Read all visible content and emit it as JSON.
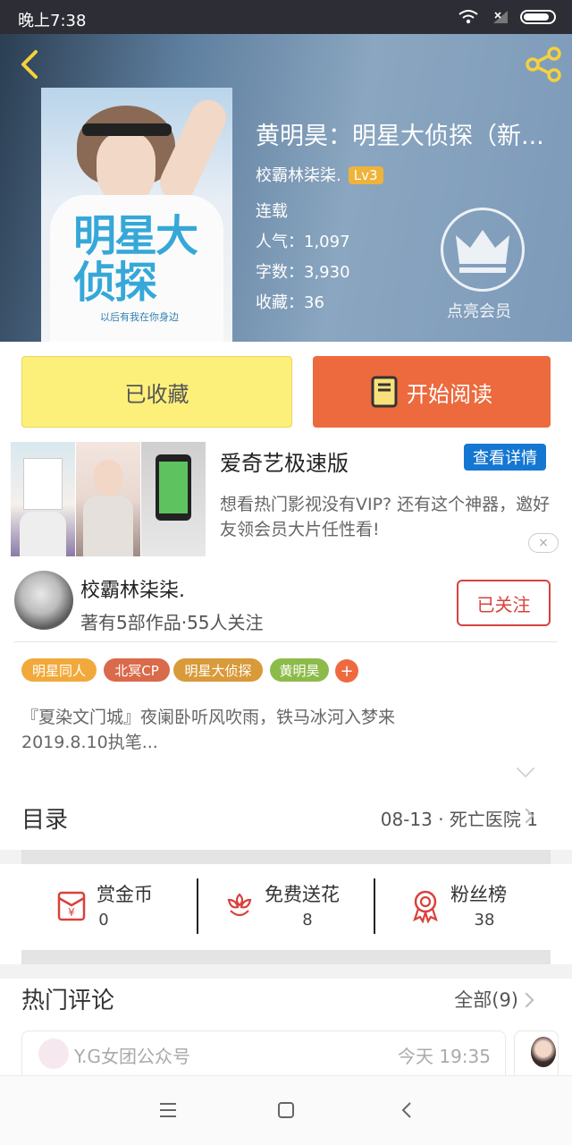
{
  "status": {
    "time": "晚上7:38"
  },
  "book": {
    "title": "黄明昊：明星大侦探（新...",
    "author": "校霸林柒柒.",
    "level": "Lv3",
    "state": "连载",
    "popularity": "人气：1,097",
    "words": "字数：3,930",
    "favorites": "收藏：36",
    "vip_label": "点亮会员",
    "cover_title": "明星大侦探",
    "cover_sub": "以后有我在你身边"
  },
  "actions": {
    "favorited": "已收藏",
    "start_read": "开始阅读"
  },
  "ad": {
    "title": "爱奇艺极速版",
    "detail_button": "查看详情",
    "desc": "想看热门影视没有VIP? 还有这个神器，邀好友领会员大片任性看!",
    "close": "×"
  },
  "author": {
    "name": "校霸林柒柒.",
    "info": "著有5部作品·55人关注",
    "follow": "已关注"
  },
  "tags": [
    {
      "label": "明星同人",
      "color": "#f2a93b"
    },
    {
      "label": "北冥CP",
      "color": "#d96a4a"
    },
    {
      "label": "明星大侦探",
      "color": "#d99a3a"
    },
    {
      "label": "黄明昊",
      "color": "#8dbb4a"
    }
  ],
  "tag_add": "+",
  "description": "『夏染文门城』夜阑卧听风吹雨，铁马冰河入梦来\n2019.8.10执笔...",
  "toc": {
    "label": "目录",
    "latest": "08-13 · 死亡医院 1"
  },
  "gifts": [
    {
      "label": "赏金币",
      "value": "0"
    },
    {
      "label": "免费送花",
      "value": "8"
    },
    {
      "label": "粉丝榜",
      "value": "38"
    }
  ],
  "comments": {
    "title": "热门评论",
    "all": "全部(9)",
    "first": {
      "user": "Y.G女团公众号",
      "time": "今天 19:35"
    }
  },
  "colors": {
    "accent": "#ec6a3e",
    "fav": "#fdf07a",
    "follow": "#d9413c",
    "ad_button": "#1677d2"
  }
}
